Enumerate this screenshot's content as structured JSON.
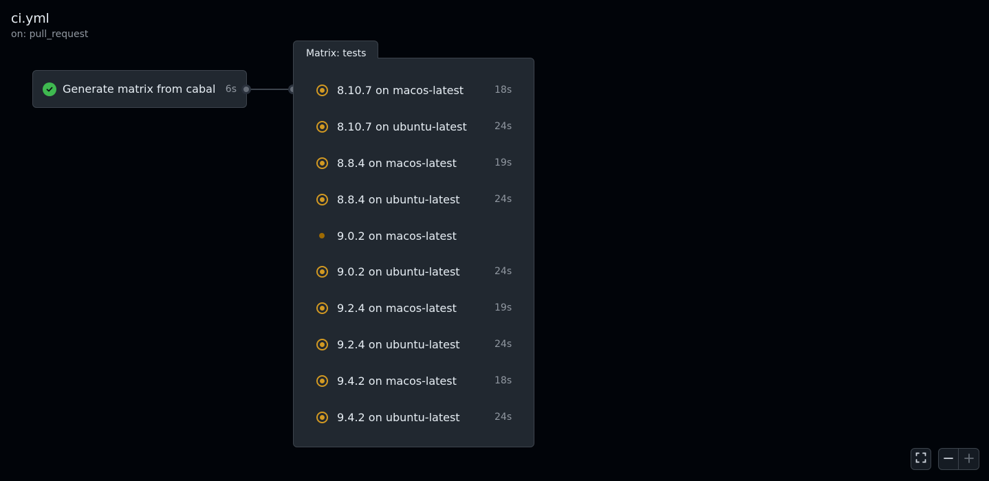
{
  "workflow": {
    "title": "ci.yml",
    "trigger": "on: pull_request"
  },
  "job": {
    "name": "Generate matrix from cabal",
    "duration": "6s",
    "status": "success"
  },
  "matrix": {
    "tab_label": "Matrix: tests",
    "items": [
      {
        "label": "8.10.7 on macos-latest",
        "time": "18s",
        "status": "in-progress"
      },
      {
        "label": "8.10.7 on ubuntu-latest",
        "time": "24s",
        "status": "in-progress"
      },
      {
        "label": "8.8.4 on macos-latest",
        "time": "19s",
        "status": "in-progress"
      },
      {
        "label": "8.8.4 on ubuntu-latest",
        "time": "24s",
        "status": "in-progress"
      },
      {
        "label": "9.0.2 on macos-latest",
        "time": "",
        "status": "queued"
      },
      {
        "label": "9.0.2 on ubuntu-latest",
        "time": "24s",
        "status": "in-progress"
      },
      {
        "label": "9.2.4 on macos-latest",
        "time": "19s",
        "status": "in-progress"
      },
      {
        "label": "9.2.4 on ubuntu-latest",
        "time": "24s",
        "status": "in-progress"
      },
      {
        "label": "9.4.2 on macos-latest",
        "time": "18s",
        "status": "in-progress"
      },
      {
        "label": "9.4.2 on ubuntu-latest",
        "time": "24s",
        "status": "in-progress"
      }
    ]
  },
  "controls": {
    "fullscreen_icon": "fullscreen-icon",
    "zoom_out_icon": "minus-icon",
    "zoom_in_icon": "plus-icon"
  },
  "colors": {
    "background": "#010409",
    "success": "#3fb950",
    "in_progress": "#d29922",
    "queued": "#9e6a03"
  }
}
